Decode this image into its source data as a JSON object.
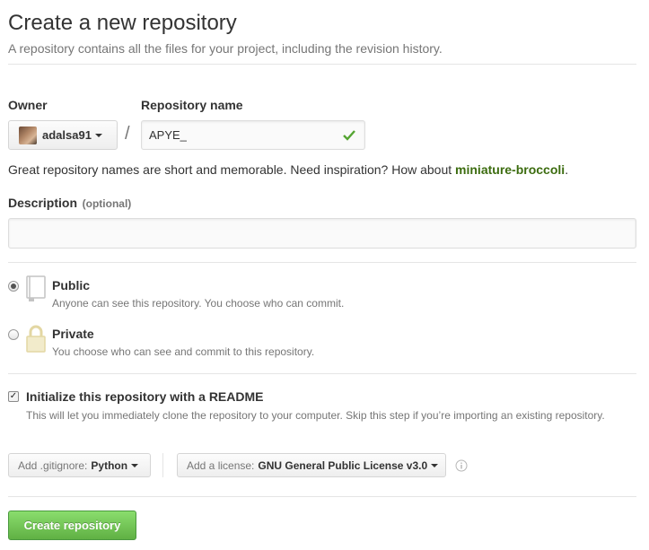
{
  "header": {
    "title": "Create a new repository",
    "subtitle": "A repository contains all the files for your project, including the revision history."
  },
  "owner": {
    "label": "Owner",
    "username": "adalsa91"
  },
  "separator": "/",
  "repo_name": {
    "label": "Repository name",
    "value": "APYE_"
  },
  "suggestion": {
    "text": "Great repository names are short and memorable. Need inspiration? How about ",
    "name": "miniature-broccoli",
    "end": "."
  },
  "description": {
    "label": "Description",
    "optional": "(optional)",
    "value": ""
  },
  "visibility": {
    "public": {
      "title": "Public",
      "desc": "Anyone can see this repository. You choose who can commit.",
      "selected": true
    },
    "private": {
      "title": "Private",
      "desc": "You choose who can see and commit to this repository.",
      "selected": false
    }
  },
  "readme": {
    "checked": true,
    "title": "Initialize this repository with a README",
    "desc": "This will let you immediately clone the repository to your computer. Skip this step if you’re importing an existing repository."
  },
  "gitignore": {
    "prefix": "Add .gitignore:",
    "value": "Python"
  },
  "license": {
    "prefix": "Add a license:",
    "value": "GNU General Public License v3.0"
  },
  "create_button": "Create repository",
  "colors": {
    "accent_green": "#55a532",
    "link_green": "#3c6c0f",
    "button_green": "#60b044"
  }
}
